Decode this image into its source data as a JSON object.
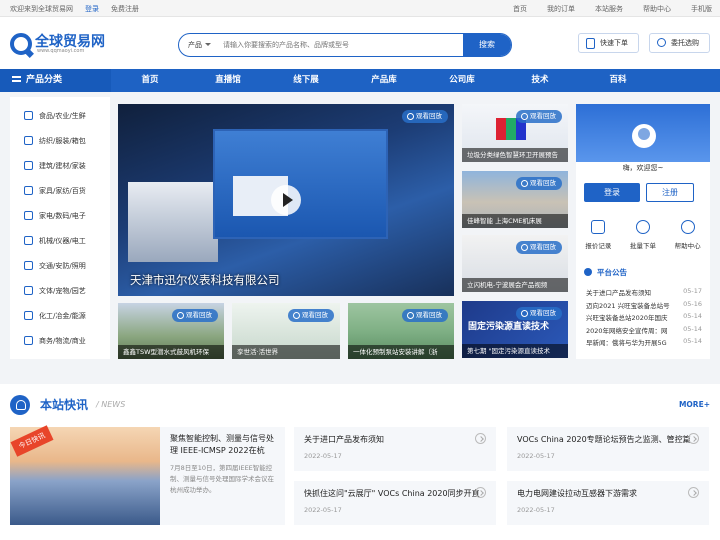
{
  "topbar": {
    "welcome": "欢迎来到全球贸易网",
    "login": "登录",
    "register": "免费注册",
    "links": [
      "首页",
      "我的订单",
      "本站服务",
      "帮助中心",
      "手机版"
    ]
  },
  "header": {
    "logo_name": "全球贸易网",
    "logo_url": "www.qqmaoyi.com",
    "search_category": "产品",
    "search_placeholder": "请输入你要搜索的产品名称、品牌或型号",
    "search_button": "搜索",
    "quick_order": "快速下单",
    "buyer_login": "委托选购"
  },
  "nav": {
    "category": "产品分类",
    "items": [
      "首页",
      "直播馆",
      "线下展",
      "产品库",
      "公司库",
      "技术",
      "百科"
    ]
  },
  "sidebar": {
    "items": [
      "食品/农业/生鲜",
      "纺织/服装/箱包",
      "建筑/建材/家装",
      "家具/家纺/百货",
      "家电/数码/电子",
      "机械/仪器/电工",
      "交通/安防/照明",
      "文体/宠物/园艺",
      "化工/冶金/能源",
      "商务/物流/商业"
    ]
  },
  "hero": {
    "badge": "观看回放",
    "caption": "天津市迅尔仪表科技有限公司"
  },
  "thumbs_right": [
    {
      "badge": "观看回放",
      "caption": "垃圾分类绿色智慧环卫开展预告"
    },
    {
      "badge": "观看回放",
      "caption": "佳峰智能 上海CME机床展"
    },
    {
      "badge": "观看回放",
      "caption": "立闪机电-宁波展会产品视频"
    },
    {
      "badge": "观看回放",
      "caption": "第七期 \"固定污染源直读技术",
      "overlay": "固定污染源直读技术"
    }
  ],
  "thumbs_bottom": [
    {
      "badge": "观看回放",
      "caption": "鑫鑫TSW型潜水式鼓风机环保"
    },
    {
      "badge": "观看回放",
      "caption": "孪世活·活世界"
    },
    {
      "badge": "观看回放",
      "caption": "一体化预制泵站安装讲解（浙"
    }
  ],
  "user_panel": {
    "greeting": "嗨，欢迎您~",
    "login": "登录",
    "register": "注册",
    "quick": [
      "报价记录",
      "批量下单",
      "帮助中心"
    ],
    "notice_title": "平台公告",
    "notices": [
      {
        "text": "关于进口产品发布须知",
        "date": "05-17"
      },
      {
        "text": "迈向2021 兴旺宝装备总站号",
        "date": "05-16"
      },
      {
        "text": "兴旺宝装备总站2020年国庆",
        "date": "05-14"
      },
      {
        "text": "2020年网络安全宣传周：网",
        "date": "05-14"
      },
      {
        "text": "早新闻：俄将与华为开展5G",
        "date": "05-14"
      }
    ]
  },
  "news": {
    "title": "本站快讯",
    "subtitle": "/ NEWS",
    "more": "MORE+",
    "featured": {
      "tag": "今日快讯",
      "title": "聚焦智能控制、测量与信号处理 IEEE-ICMSP 2022在杭",
      "summary": "7月8日至10日，第四届IEEE智能控制、测量与信号处理国际学术会议在杭州成功举办。"
    },
    "cards": [
      {
        "title": "关于进口产品发布须知",
        "date": "2022-05-17"
      },
      {
        "title": "VOCs China 2020专题论坛预告之监测、管控篇",
        "date": "2022-05-17"
      },
      {
        "title": "快抓住这问\"云展厅\" VOCs China 2020同步开直",
        "date": "2022-05-17"
      },
      {
        "title": "电力电网建设拉动互感器下游需求",
        "date": "2022-05-17"
      }
    ]
  }
}
